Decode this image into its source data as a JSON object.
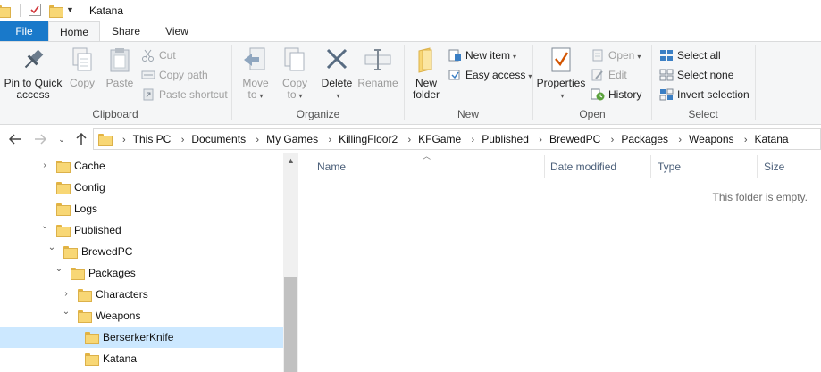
{
  "window": {
    "title": "Katana"
  },
  "ribbon_tabs": [
    "File",
    "Home",
    "Share",
    "View"
  ],
  "clipboard": {
    "label": "Clipboard",
    "pin_line1": "Pin to Quick",
    "pin_line2": "access",
    "copy": "Copy",
    "paste": "Paste",
    "cut": "Cut",
    "copy_path": "Copy path",
    "paste_shortcut": "Paste shortcut"
  },
  "organize": {
    "label": "Organize",
    "move_line1": "Move",
    "move_line2": "to",
    "copy_line1": "Copy",
    "copy_line2": "to",
    "delete": "Delete",
    "rename": "Rename"
  },
  "new": {
    "label": "New",
    "folder_line1": "New",
    "folder_line2": "folder",
    "new_item": "New item",
    "easy_access": "Easy access"
  },
  "open": {
    "label": "Open",
    "properties": "Properties",
    "open": "Open",
    "edit": "Edit",
    "history": "History"
  },
  "select": {
    "label": "Select",
    "select_all": "Select all",
    "select_none": "Select none",
    "invert": "Invert selection"
  },
  "address": {
    "crumbs": [
      "This PC",
      "Documents",
      "My Games",
      "KillingFloor2",
      "KFGame",
      "Published",
      "BrewedPC",
      "Packages",
      "Weapons",
      "Katana"
    ]
  },
  "tree": [
    {
      "label": "Cache",
      "chevron": "›"
    },
    {
      "label": "Config",
      "chevron": ""
    },
    {
      "label": "Logs",
      "chevron": ""
    },
    {
      "label": "Published",
      "chevron": "⌄"
    },
    {
      "label": "BrewedPC",
      "chevron": "⌄"
    },
    {
      "label": "Packages",
      "chevron": "⌄"
    },
    {
      "label": "Characters",
      "chevron": "›"
    },
    {
      "label": "Weapons",
      "chevron": "⌄"
    },
    {
      "label": "BerserkerKnife",
      "chevron": "",
      "selected": true
    },
    {
      "label": "Katana",
      "chevron": ""
    }
  ],
  "columns": [
    "Name",
    "Date modified",
    "Type",
    "Size"
  ],
  "content": {
    "empty_message": "This folder is empty."
  },
  "colors": {
    "accent": "#1979ca",
    "selection": "#cce8ff",
    "folder": "#f8d775"
  }
}
